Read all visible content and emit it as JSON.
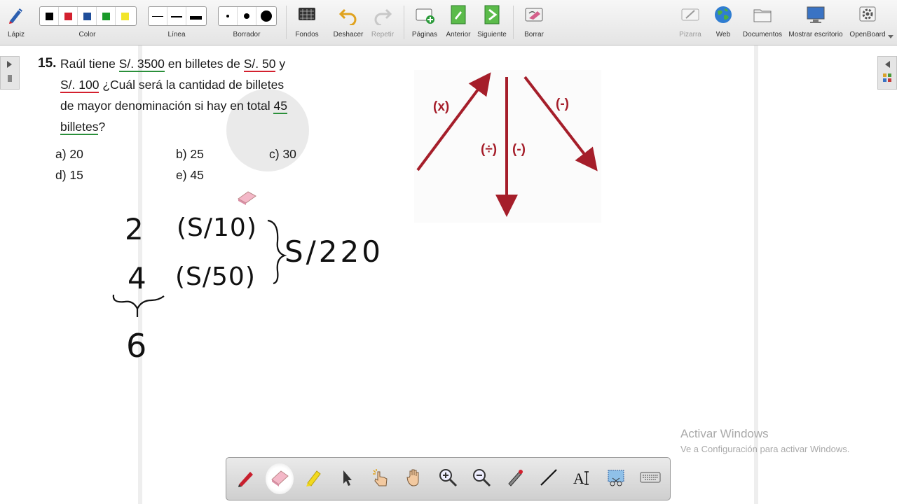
{
  "toolbar": {
    "pen_label": "Lápiz",
    "color_label": "Color",
    "line_label": "Línea",
    "eraser_label": "Borrador",
    "backgrounds_label": "Fondos",
    "undo_label": "Deshacer",
    "redo_label": "Repetir",
    "pages_label": "Páginas",
    "previous_label": "Anterior",
    "next_label": "Siguiente",
    "clear_label": "Borrar",
    "board_label": "Pizarra",
    "web_label": "Web",
    "documents_label": "Documentos",
    "show_desktop_label": "Mostrar escritorio",
    "openboard_label": "OpenBoard",
    "colors": [
      "#000000",
      "#d3202e",
      "#1f4e9a",
      "#1a9a2a",
      "#f2e52a"
    ]
  },
  "question": {
    "number": "15.",
    "line1_pre": "Raúl tiene ",
    "amount": "S/. 3500",
    "line1_mid": " en billetes de ",
    "denom_small": "S/. 50",
    "line1_post": " y",
    "denom_large": "S/. 100",
    "line2_post": " ¿Cuál será la cantidad de billetes",
    "line3_pre": "de mayor denominación si hay en total ",
    "total": "45",
    "last_word": "billetes",
    "question_mark": "?"
  },
  "options": {
    "a": "a)  20",
    "b": "b)  25",
    "c": "c)  30",
    "d": "d) 15",
    "e": "e)  45"
  },
  "diagram": {
    "label_mult": "(x)",
    "label_div": "(÷)",
    "label_sub_mid": "(-)",
    "label_sub_right": "(-)"
  },
  "handwriting": {
    "row1_left": "2",
    "row1_right": "(S/10)",
    "row2_left": "4",
    "row2_right": "(S/50)",
    "sum": "6",
    "result": "S/220"
  },
  "watermark": {
    "title": "Activar Windows",
    "subtitle": "Ve a Configuración para activar Windows."
  }
}
